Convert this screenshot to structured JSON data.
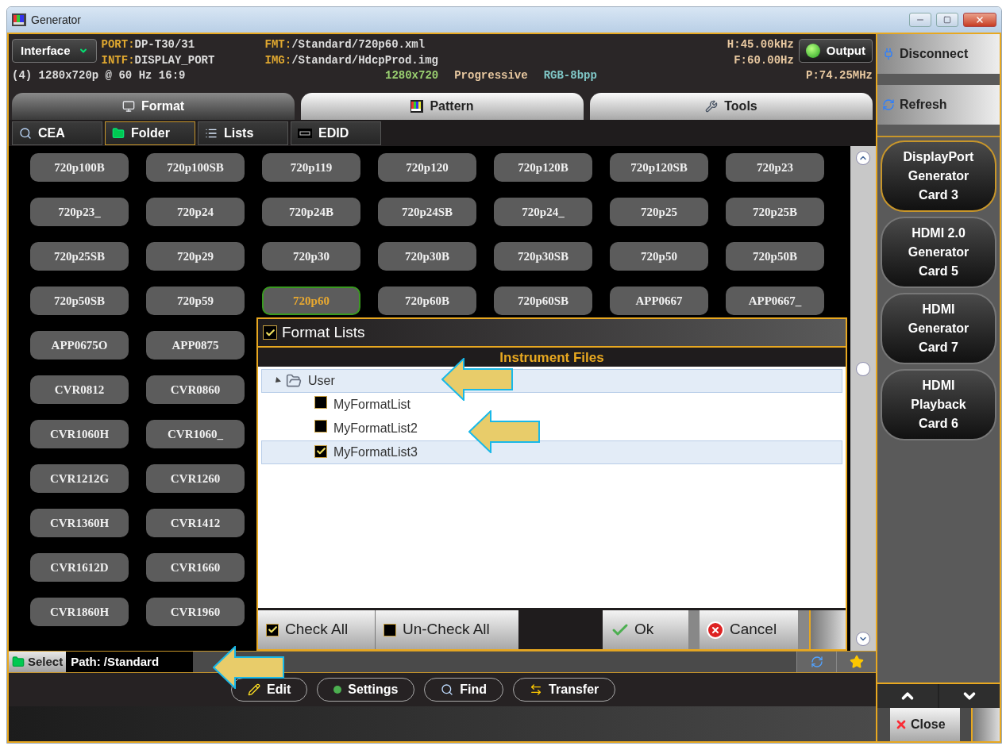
{
  "window": {
    "title": "Generator"
  },
  "header": {
    "interface_button": "Interface",
    "port_label": "PORT:",
    "port": "DP-T30/31",
    "intf_label": "INTF:",
    "intf": "DISPLAY_PORT",
    "fmt_label": "FMT:",
    "fmt": "/Standard/720p60.xml",
    "img_label": "IMG:",
    "img": "/Standard/HdcpProd.img",
    "mode": "(4) 1280x720p @ 60 Hz 16:9",
    "resolution": "1280x720",
    "scan": "Progressive",
    "color_format": "RGB-8bpp",
    "h_freq": "H:45.00kHz",
    "f_freq": "F:60.00Hz",
    "pixel_clock": "P:74.25MHz",
    "output_button": {
      "label": "Output",
      "on": true
    }
  },
  "tabs": [
    {
      "label": "Format",
      "kind": "format",
      "selected": true
    },
    {
      "label": "Pattern",
      "kind": "pattern",
      "selected": false
    },
    {
      "label": "Tools",
      "kind": "tools",
      "selected": false
    }
  ],
  "subtabs": [
    {
      "label": "CEA",
      "kind": "cea",
      "selected": false
    },
    {
      "label": "Folder",
      "kind": "folder",
      "selected": true
    },
    {
      "label": "Lists",
      "kind": "lists",
      "selected": false
    },
    {
      "label": "EDID",
      "kind": "edid",
      "selected": false
    }
  ],
  "format_buttons": [
    [
      {
        "label": "720p100B",
        "selected": false
      },
      {
        "label": "720p100SB",
        "selected": false
      },
      {
        "label": "720p119",
        "selected": false
      },
      {
        "label": "720p120",
        "selected": false
      },
      {
        "label": "720p120B",
        "selected": false
      },
      {
        "label": "720p120SB",
        "selected": false
      },
      {
        "label": "720p23",
        "selected": false
      }
    ],
    [
      {
        "label": "720p23_",
        "selected": false
      },
      {
        "label": "720p24",
        "selected": false
      },
      {
        "label": "720p24B",
        "selected": false
      },
      {
        "label": "720p24SB",
        "selected": false
      },
      {
        "label": "720p24_",
        "selected": false
      },
      {
        "label": "720p25",
        "selected": false
      },
      {
        "label": "720p25B",
        "selected": false
      }
    ],
    [
      {
        "label": "720p25SB",
        "selected": false
      },
      {
        "label": "720p29",
        "selected": false
      },
      {
        "label": "720p30",
        "selected": false
      },
      {
        "label": "720p30B",
        "selected": false
      },
      {
        "label": "720p30SB",
        "selected": false
      },
      {
        "label": "720p50",
        "selected": false
      },
      {
        "label": "720p50B",
        "selected": false
      }
    ],
    [
      {
        "label": "720p50SB",
        "selected": false
      },
      {
        "label": "720p59",
        "selected": false
      },
      {
        "label": "720p60",
        "selected": true
      },
      {
        "label": "720p60B",
        "selected": false
      },
      {
        "label": "720p60SB",
        "selected": false
      },
      {
        "label": "APP0667",
        "selected": false
      },
      {
        "label": "APP0667_",
        "selected": false
      }
    ],
    [
      {
        "label": "APP0675O",
        "selected": false
      },
      {
        "label": "APP0875",
        "selected": false
      }
    ],
    [
      {
        "label": "CVR0812",
        "selected": false
      },
      {
        "label": "CVR0860",
        "selected": false
      }
    ],
    [
      {
        "label": "CVR1060H",
        "selected": false
      },
      {
        "label": "CVR1060_",
        "selected": false
      }
    ],
    [
      {
        "label": "CVR1212G",
        "selected": false
      },
      {
        "label": "CVR1260",
        "selected": false
      }
    ],
    [
      {
        "label": "CVR1360H",
        "selected": false
      },
      {
        "label": "CVR1412",
        "selected": false
      }
    ],
    [
      {
        "label": "CVR1612D",
        "selected": false
      },
      {
        "label": "CVR1660",
        "selected": false
      }
    ],
    [
      {
        "label": "CVR1860H",
        "selected": false
      },
      {
        "label": "CVR1960",
        "selected": false
      }
    ]
  ],
  "dialog": {
    "title": "Format Lists",
    "checked": true,
    "header": "Instrument Files",
    "tree": [
      {
        "label": "User",
        "expanded": true,
        "selected": true,
        "children": [
          {
            "label": "MyFormatList",
            "checked": false,
            "selected": false
          },
          {
            "label": "MyFormatList2",
            "checked": false,
            "selected": false
          },
          {
            "label": "MyFormatList3",
            "checked": true,
            "selected": true
          }
        ]
      }
    ],
    "check_all": {
      "label": "Check All",
      "checked": true
    },
    "uncheck_all": {
      "label": "Un-Check All",
      "checked": false
    },
    "ok_button": "Ok",
    "cancel_button": "Cancel"
  },
  "path_bar": {
    "select_button": "Select",
    "path": "Path: /Standard"
  },
  "toolbar": [
    {
      "label": "Edit",
      "kind": "edit"
    },
    {
      "label": "Settings",
      "kind": "settings"
    },
    {
      "label": "Find",
      "kind": "find"
    },
    {
      "label": "Transfer",
      "kind": "transfer"
    }
  ],
  "side_actions": [
    {
      "label": "Disconnect",
      "kind": "disconnect"
    },
    {
      "label": "Refresh",
      "kind": "refresh"
    }
  ],
  "cards": [
    {
      "lines": [
        "DisplayPort",
        "Generator",
        "Card 3"
      ],
      "selected": true
    },
    {
      "lines": [
        "HDMI 2.0",
        "Generator",
        "Card 5"
      ],
      "selected": false
    },
    {
      "lines": [
        "HDMI",
        "Generator",
        "Card 7"
      ],
      "selected": false
    },
    {
      "lines": [
        "HDMI",
        "Playback",
        "Card 6"
      ],
      "selected": false
    }
  ],
  "close_button": "Close"
}
